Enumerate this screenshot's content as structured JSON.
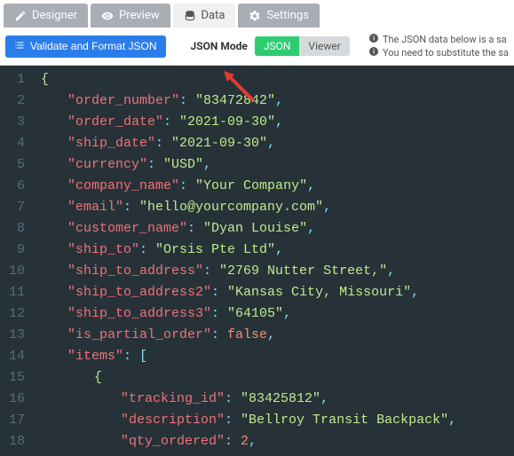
{
  "tabs": {
    "designer": "Designer",
    "preview": "Preview",
    "data": "Data",
    "settings": "Settings"
  },
  "toolbar": {
    "validate": "Validate and Format JSON",
    "mode_label": "JSON Mode",
    "mode_json": "JSON",
    "mode_viewer": "Viewer"
  },
  "info": {
    "line1": "The JSON data below is a sa",
    "line2": "You need to substitute the sa"
  },
  "code": {
    "lines": [
      {
        "n": "1",
        "type": "brace",
        "indent": 0,
        "text": "{"
      },
      {
        "n": "2",
        "type": "kv",
        "indent": 1,
        "key": "order_number",
        "val": "83472842",
        "vtype": "string",
        "comma": true
      },
      {
        "n": "3",
        "type": "kv",
        "indent": 1,
        "key": "order_date",
        "val": "2021-09-30",
        "vtype": "string",
        "comma": true
      },
      {
        "n": "4",
        "type": "kv",
        "indent": 1,
        "key": "ship_date",
        "val": "2021-09-30",
        "vtype": "string",
        "comma": true
      },
      {
        "n": "5",
        "type": "kv",
        "indent": 1,
        "key": "currency",
        "val": "USD",
        "vtype": "string",
        "comma": true
      },
      {
        "n": "6",
        "type": "kv",
        "indent": 1,
        "key": "company_name",
        "val": "Your Company",
        "vtype": "string",
        "comma": true
      },
      {
        "n": "7",
        "type": "kv",
        "indent": 1,
        "key": "email",
        "val": "hello@yourcompany.com",
        "vtype": "string",
        "comma": true
      },
      {
        "n": "8",
        "type": "kv",
        "indent": 1,
        "key": "customer_name",
        "val": "Dyan Louise",
        "vtype": "string",
        "comma": true
      },
      {
        "n": "9",
        "type": "kv",
        "indent": 1,
        "key": "ship_to",
        "val": "Orsis Pte Ltd",
        "vtype": "string",
        "comma": true
      },
      {
        "n": "10",
        "type": "kv",
        "indent": 1,
        "key": "ship_to_address",
        "val": "2769 Nutter Street,",
        "vtype": "string",
        "comma": true
      },
      {
        "n": "11",
        "type": "kv",
        "indent": 1,
        "key": "ship_to_address2",
        "val": "Kansas City, Missouri",
        "vtype": "string",
        "comma": true
      },
      {
        "n": "12",
        "type": "kv",
        "indent": 1,
        "key": "ship_to_address3",
        "val": "64105",
        "vtype": "string",
        "comma": true
      },
      {
        "n": "13",
        "type": "kv",
        "indent": 1,
        "key": "is_partial_order",
        "val": "false",
        "vtype": "bool",
        "comma": true
      },
      {
        "n": "14",
        "type": "karr",
        "indent": 1,
        "key": "items"
      },
      {
        "n": "15",
        "type": "brace",
        "indent": 2,
        "text": "{"
      },
      {
        "n": "16",
        "type": "kv",
        "indent": 3,
        "key": "tracking_id",
        "val": "83425812",
        "vtype": "string",
        "comma": true
      },
      {
        "n": "17",
        "type": "kv",
        "indent": 3,
        "key": "description",
        "val": "Bellroy Transit Backpack",
        "vtype": "string",
        "comma": true
      },
      {
        "n": "18",
        "type": "kv",
        "indent": 3,
        "key": "qty_ordered",
        "val": "2",
        "vtype": "num",
        "comma": true
      }
    ]
  }
}
